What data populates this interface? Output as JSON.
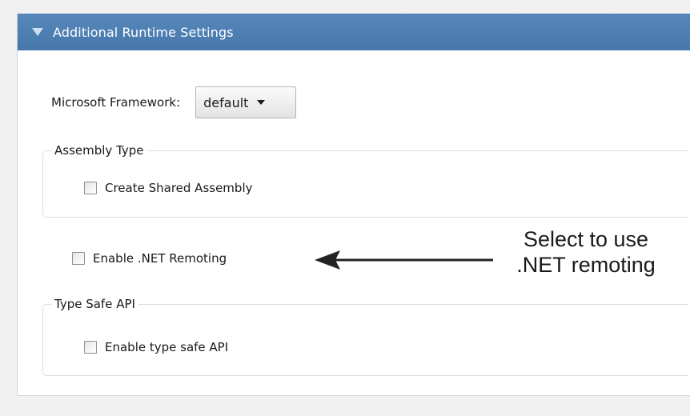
{
  "panel": {
    "title": "Additional Runtime Settings",
    "toggle_icon": "triangle-down-icon"
  },
  "framework": {
    "label": "Microsoft Framework:",
    "selected": "default",
    "arrow_icon": "chevron-down-icon"
  },
  "assembly_group": {
    "legend": "Assembly Type",
    "checkbox_label": "Create Shared Assembly",
    "checked": false
  },
  "remoting": {
    "checkbox_label": "Enable .NET Remoting",
    "checked": false
  },
  "typesafe_group": {
    "legend": "Type Safe API",
    "checkbox_label": "Enable type safe API",
    "checked": false
  },
  "annotation": {
    "line1": "Select to use",
    "line2": ".NET remoting",
    "arrow_icon": "left-arrow-icon"
  },
  "colors": {
    "header": "#4f80b3",
    "header_text": "#ffffff",
    "background": "#f1f1f1"
  }
}
